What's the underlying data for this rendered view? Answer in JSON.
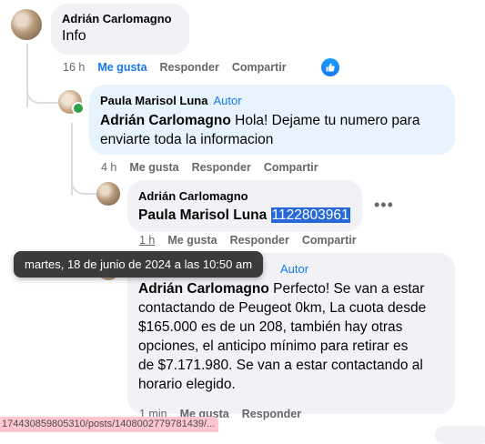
{
  "comment1": {
    "author": "Adrián Carlomagno",
    "text": "Info",
    "time": "16 h",
    "like": "Me gusta",
    "reply": "Responder",
    "share": "Compartir"
  },
  "comment2": {
    "author": "Paula Marisol Luna",
    "badge": "Autor",
    "mention": "Adrián Carlomagno",
    "text_line1": " Hola! Dejame tu numero para",
    "text_line2": "enviarte toda la informacion",
    "time": "4 h",
    "like": "Me gusta",
    "reply": "Responder",
    "share": "Compartir"
  },
  "comment3": {
    "author": "Adrián Carlomagno",
    "mention": "Paula Marisol Luna",
    "phone": "1122803961",
    "time": "1 h",
    "like": "Me gusta",
    "reply": "Responder",
    "share": "Compartir",
    "more": "•••"
  },
  "tooltip": {
    "text": "martes, 18 de junio de 2024 a las 10:50 am"
  },
  "comment4": {
    "badge": "Autor",
    "mention": "Adrián Carlomagno",
    "lines": [
      " Perfecto! Se van a estar",
      "contactando de Peugeot 0km, La cuota desde",
      "$165.000 es de un 208, también hay otras",
      "opciones, el anticipo mínimo para retirar es",
      "de $7.171.980. Se van a estar contactando al",
      "horario elegido."
    ],
    "time": "1 min",
    "like": "Me gusta",
    "reply": "Responder"
  },
  "statusbar": {
    "url": "174430859805310/posts/1408002779781439/..."
  },
  "icons": {
    "like_reaction": "thumbs-up-icon",
    "online": "online-dot-icon"
  }
}
